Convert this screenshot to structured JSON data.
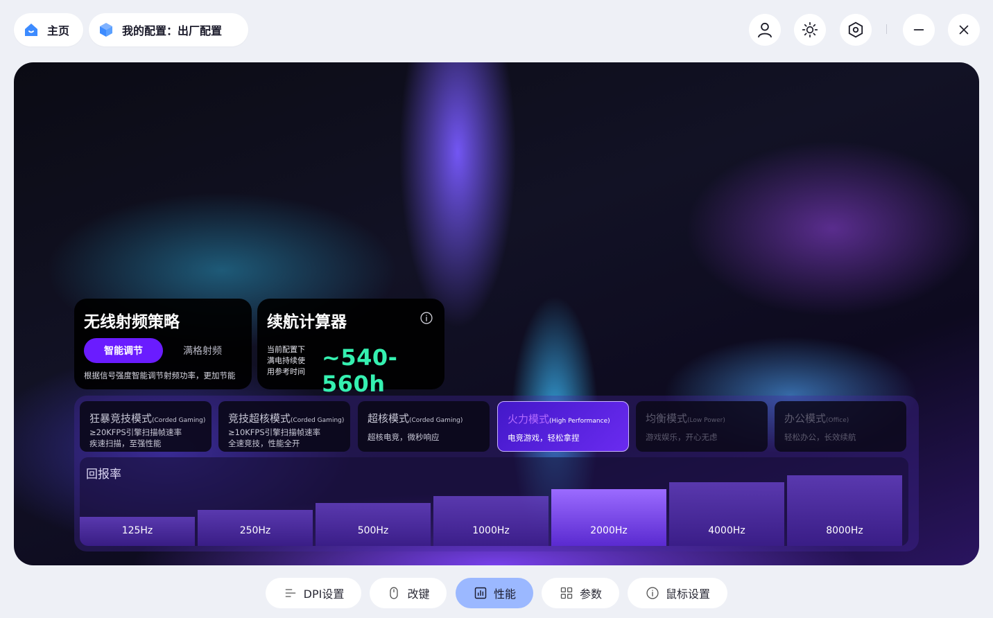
{
  "topbar": {
    "home_label": "主页",
    "config_label": "我的配置：出厂配置",
    "icons": [
      "user-icon",
      "brightness-icon",
      "settings-hex-icon",
      "minimize-icon",
      "close-icon"
    ]
  },
  "rf_strategy": {
    "title": "无线射频策略",
    "option_smart": "智能调节",
    "option_full": "满格射频",
    "description": "根据信号强度智能调节射频功率，更加节能"
  },
  "battery": {
    "title": "续航计算器",
    "sub_line1": "当前配置下",
    "sub_line2": "满电持续使",
    "sub_line3": "用参考时间",
    "value": "~540-560h"
  },
  "modes": [
    {
      "title": "狂暴竞技模式",
      "tag": "(Corded Gaming)",
      "line1": "≥20KFPS引擎扫描帧速率",
      "line2": "疾速扫描，至强性能"
    },
    {
      "title": "竞技超核模式",
      "tag": "(Corded Gaming)",
      "line1": "≥10KFPS引擎扫描帧速率",
      "line2": "全速竞技，性能全开"
    },
    {
      "title": "超核模式",
      "tag": "(Corded Gaming)",
      "line1": "超核电竞，微秒响应"
    },
    {
      "title": "火力模式",
      "tag": "(High Performance)",
      "line1": "电竞游戏，轻松拿捏"
    },
    {
      "title": "均衡模式",
      "tag": "(Low Power)",
      "line1": "游戏娱乐，开心无虑"
    },
    {
      "title": "办公模式",
      "tag": "(Office)",
      "line1": "轻松办公，长效续航"
    }
  ],
  "polling": {
    "title": "回报率",
    "rates": [
      "125Hz",
      "250Hz",
      "500Hz",
      "1000Hz",
      "2000Hz",
      "4000Hz",
      "8000Hz"
    ],
    "selected": "2000Hz"
  },
  "nav": {
    "dpi": "DPI设置",
    "remap": "改键",
    "performance": "性能",
    "params": "参数",
    "mouse_settings": "鼠标设置"
  },
  "colors": {
    "accent": "#6a1cff",
    "battery_value": "#35f0b0",
    "active_tab": "#9bb8ff"
  }
}
